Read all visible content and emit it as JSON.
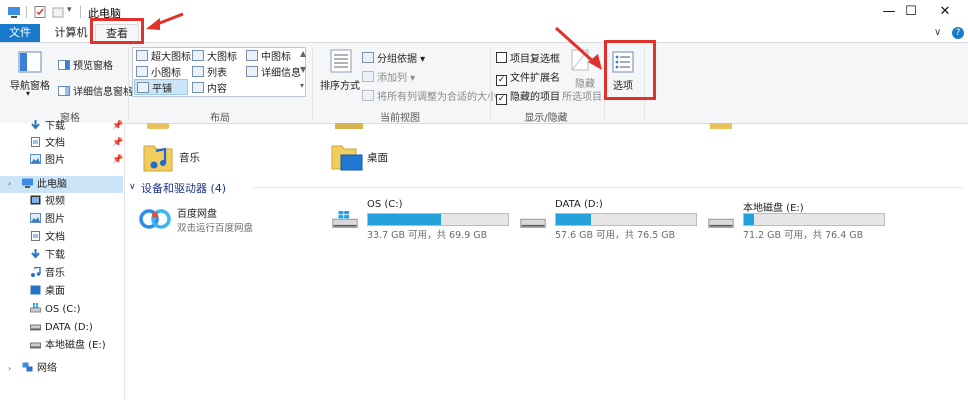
{
  "window": {
    "title": "此电脑",
    "minimize": "—",
    "maximize": "☐",
    "close": "✕"
  },
  "tabs": {
    "file": "文件",
    "computer": "计算机",
    "view": "查看",
    "collapse": "∨",
    "help": "?"
  },
  "ribbon": {
    "panes": {
      "label": "窗格",
      "nav_pane": "导航窗格",
      "nav_pane_arrow": "▾",
      "preview_pane": "预览窗格",
      "details_pane": "详细信息窗格"
    },
    "layout": {
      "label": "布局",
      "items": [
        "超大图标",
        "大图标",
        "中图标",
        "小图标",
        "列表",
        "详细信息",
        "平铺",
        "内容"
      ],
      "active": "平铺"
    },
    "current_view": {
      "label": "当前视图",
      "sort_by": "排序方式",
      "group_by": "分组依据",
      "add_columns": "添加列",
      "size_all_columns": "将所有列调整为合适的大小"
    },
    "show_hide": {
      "label": "显示/隐藏",
      "item_checkboxes": "项目复选框",
      "item_checkboxes_checked": false,
      "file_extensions": "文件扩展名",
      "file_extensions_checked": true,
      "hidden_items": "隐藏的项目",
      "hidden_items_checked": true,
      "hide_selected_1": "隐藏",
      "hide_selected_2": "所选项目"
    },
    "options": {
      "label": "选项"
    }
  },
  "sidebar": {
    "quick": [
      {
        "label": "下载",
        "icon": "download-icon"
      },
      {
        "label": "文档",
        "icon": "document-icon"
      },
      {
        "label": "图片",
        "icon": "picture-icon"
      }
    ],
    "this_pc": "此电脑",
    "pc_items": [
      {
        "label": "视频",
        "icon": "video-icon"
      },
      {
        "label": "图片",
        "icon": "picture-icon"
      },
      {
        "label": "文档",
        "icon": "document-icon"
      },
      {
        "label": "下载",
        "icon": "download-icon"
      },
      {
        "label": "音乐",
        "icon": "music-icon"
      },
      {
        "label": "桌面",
        "icon": "desktop-icon"
      },
      {
        "label": "OS (C:)",
        "icon": "os-drive-icon"
      },
      {
        "label": "DATA (D:)",
        "icon": "drive-icon"
      },
      {
        "label": "本地磁盘 (E:)",
        "icon": "drive-icon"
      }
    ],
    "network": "网络"
  },
  "content": {
    "folders": [
      {
        "label": "音乐",
        "icon": "music-folder-icon"
      },
      {
        "label": "桌面",
        "icon": "desktop-folder-icon"
      }
    ],
    "devices_header": "设备和驱动器 (4)",
    "baidu": {
      "name": "百度网盘",
      "desc": "双击运行百度网盘"
    },
    "drives": [
      {
        "name": "OS (C:)",
        "info": "33.7 GB 可用，共 69.9 GB",
        "used_fraction": 0.52
      },
      {
        "name": "DATA (D:)",
        "info": "57.6 GB 可用，共 76.5 GB",
        "used_fraction": 0.25
      },
      {
        "name": "本地磁盘 (E:)",
        "info": "71.2 GB 可用，共 76.4 GB",
        "used_fraction": 0.07
      }
    ]
  },
  "colors": {
    "accent": "#1979ca",
    "annotation": "#e2312b",
    "drive_fill": "#26a0da"
  }
}
